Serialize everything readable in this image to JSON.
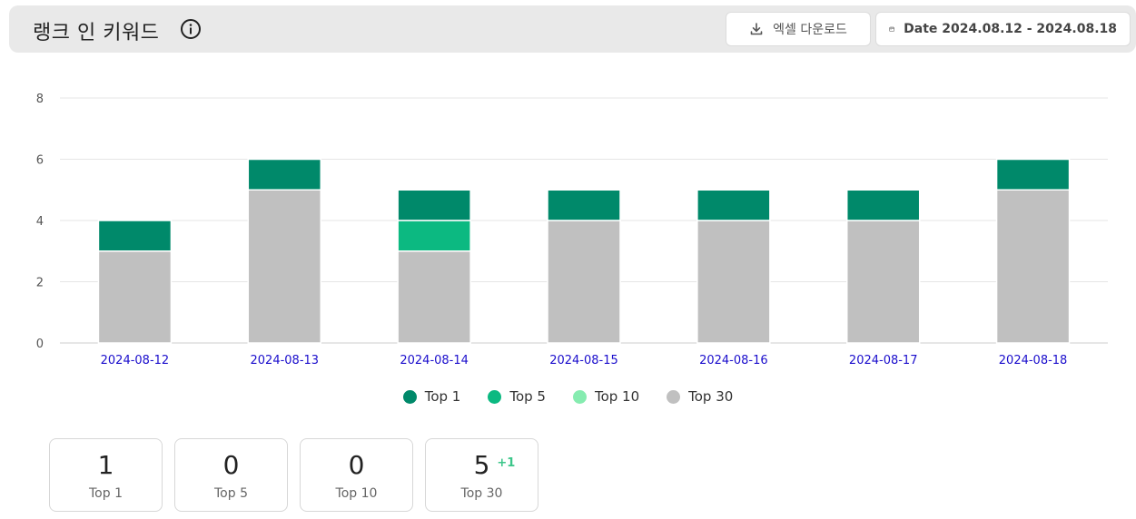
{
  "header": {
    "title": "랭크 인 키워드",
    "excel_label": "엑셀 다운로드",
    "date_label": "Date 2024.08.12 - 2024.08.18"
  },
  "colors": {
    "top1": "#00896a",
    "top5": "#0cb981",
    "top10": "#86ecb0",
    "top30": "#c0c0c0",
    "axis_label": "#1a0dcc",
    "delta": "#3cc68a"
  },
  "chart_data": {
    "type": "bar",
    "stacked": true,
    "categories": [
      "2024-08-12",
      "2024-08-13",
      "2024-08-14",
      "2024-08-15",
      "2024-08-16",
      "2024-08-17",
      "2024-08-18"
    ],
    "series": [
      {
        "name": "Top 30",
        "values": [
          3,
          5,
          3,
          4,
          4,
          4,
          5
        ]
      },
      {
        "name": "Top 10",
        "values": [
          0,
          0,
          0,
          0,
          0,
          0,
          0
        ]
      },
      {
        "name": "Top 5",
        "values": [
          0,
          0,
          1,
          0,
          0,
          0,
          0
        ]
      },
      {
        "name": "Top 1",
        "values": [
          1,
          1,
          1,
          1,
          1,
          1,
          1
        ]
      }
    ],
    "ylim": [
      0,
      8
    ],
    "yticks": [
      0,
      2,
      4,
      6,
      8
    ],
    "grid": true,
    "legend": "bottom",
    "legend_order": [
      "Top 1",
      "Top 5",
      "Top 10",
      "Top 30"
    ]
  },
  "summary_cards": [
    {
      "value": "1",
      "label": "Top 1",
      "delta": ""
    },
    {
      "value": "0",
      "label": "Top 5",
      "delta": ""
    },
    {
      "value": "0",
      "label": "Top 10",
      "delta": ""
    },
    {
      "value": "5",
      "label": "Top 30",
      "delta": "+1"
    }
  ]
}
